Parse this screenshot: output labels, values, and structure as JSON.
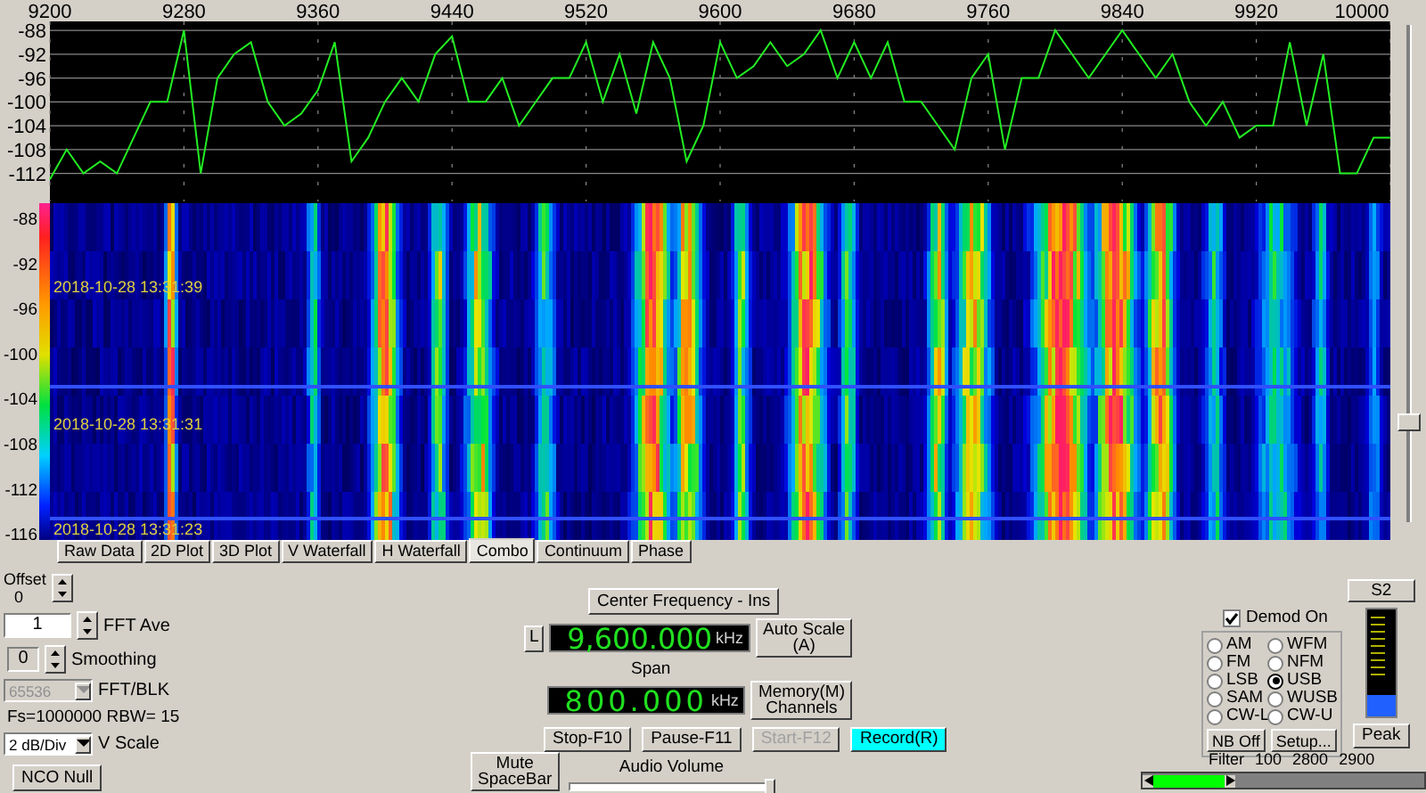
{
  "spectrum": {
    "chart_data": {
      "type": "line",
      "x": [
        9200,
        9210,
        9220,
        9230,
        9240,
        9250,
        9260,
        9270,
        9280,
        9290,
        9300,
        9310,
        9320,
        9330,
        9340,
        9350,
        9360,
        9370,
        9380,
        9390,
        9400,
        9410,
        9420,
        9430,
        9440,
        9450,
        9460,
        9470,
        9480,
        9490,
        9500,
        9510,
        9520,
        9530,
        9540,
        9550,
        9560,
        9570,
        9580,
        9590,
        9600,
        9610,
        9620,
        9630,
        9640,
        9650,
        9660,
        9670,
        9680,
        9690,
        9700,
        9710,
        9720,
        9730,
        9740,
        9750,
        9760,
        9770,
        9780,
        9790,
        9800,
        9810,
        9820,
        9830,
        9840,
        9850,
        9860,
        9870,
        9880,
        9890,
        9900,
        9910,
        9920,
        9930,
        9940,
        9950,
        9960,
        9970,
        9980,
        9990,
        10000
      ],
      "series": [
        {
          "color": "#22ee22",
          "values": [
            -113,
            -108,
            -112,
            -110,
            -112,
            -106,
            -100,
            -100,
            -88,
            -112,
            -96,
            -92,
            -90,
            -100,
            -104,
            -102,
            -98,
            -90,
            -110,
            -106,
            -100,
            -96,
            -100,
            -92,
            -89,
            -100,
            -100,
            -96,
            -104,
            -100,
            -96,
            -96,
            -90,
            -100,
            -92,
            -102,
            -90,
            -96,
            -110,
            -104,
            -90,
            -96,
            -94,
            -90,
            -94,
            -92,
            -88,
            -96,
            -90,
            -96,
            -90,
            -100,
            -100,
            -104,
            -108,
            -96,
            -92,
            -108,
            -96,
            -96,
            -88,
            -92,
            -96,
            -92,
            -88,
            -92,
            -96,
            -92,
            -100,
            -104,
            -100,
            -106,
            -104,
            -104,
            -90,
            -104,
            -92,
            -112,
            -112,
            -106,
            -106
          ]
        }
      ],
      "xlim": [
        9200,
        10000
      ],
      "ylim": [
        -117,
        -86.5
      ],
      "xticks": [
        9200,
        9280,
        9360,
        9440,
        9520,
        9600,
        9680,
        9760,
        9840,
        9920,
        10000
      ],
      "yticks": [
        -88,
        -92,
        -96,
        -100,
        -104,
        -108,
        -112
      ],
      "grid": true
    }
  },
  "waterfall": {
    "db_labels": [
      "-88",
      "-92",
      "-96",
      "-100",
      "-104",
      "-108",
      "-112",
      "-116"
    ],
    "timestamps": [
      "2018-10-28 13:31:39",
      "2018-10-28 13:31:31",
      "2018-10-28 13:31:23"
    ]
  },
  "side_slider": {
    "level": 0.22
  },
  "tabs": [
    {
      "label": "Raw Data",
      "selected": false
    },
    {
      "label": "2D Plot",
      "selected": false
    },
    {
      "label": "3D Plot",
      "selected": false
    },
    {
      "label": "V Waterfall",
      "selected": false
    },
    {
      "label": "H Waterfall",
      "selected": false
    },
    {
      "label": "Combo",
      "selected": true
    },
    {
      "label": "Continuum",
      "selected": false
    },
    {
      "label": "Phase",
      "selected": false
    }
  ],
  "offset": {
    "label": "Offset",
    "value": "0"
  },
  "fft_ave": {
    "value": "1",
    "label": "FFT Ave"
  },
  "smoothing": {
    "value": "0",
    "label": "Smoothing"
  },
  "fft_blk": {
    "value": "65536",
    "label": "FFT/BLK",
    "disabled": true
  },
  "sample_info": "Fs=1000000 RBW= 15",
  "v_scale": {
    "value": "2 dB/Div",
    "label": "V Scale"
  },
  "nco_null": "NCO Null",
  "center_frequency": {
    "button": "Center Frequency - Ins",
    "lock": "L",
    "value": "9,600.000",
    "unit": "kHz"
  },
  "auto_scale": [
    "Auto Scale",
    "(A)"
  ],
  "span": {
    "label": "Span",
    "value": "800.000",
    "unit": "kHz"
  },
  "memory": [
    "Memory(M)",
    "Channels"
  ],
  "transport": [
    {
      "label": "Stop-F10",
      "disabled": false,
      "active": false
    },
    {
      "label": "Pause-F11",
      "disabled": false,
      "active": false
    },
    {
      "label": "Start-F12",
      "disabled": true,
      "active": false
    },
    {
      "label": "Record(R)",
      "disabled": false,
      "active": true
    }
  ],
  "mute": [
    "Mute",
    "SpaceBar"
  ],
  "audio_volume": {
    "label": "Audio Volume",
    "level": 1.0
  },
  "s_meter": {
    "button": "S2",
    "level": 0.2
  },
  "demod": {
    "label": "Demod On",
    "checked": true,
    "modes": [
      {
        "label": "AM",
        "selected": false
      },
      {
        "label": "WFM",
        "selected": false
      },
      {
        "label": "FM",
        "selected": false
      },
      {
        "label": "NFM",
        "selected": false
      },
      {
        "label": "LSB",
        "selected": false
      },
      {
        "label": "USB",
        "selected": true
      },
      {
        "label": "SAM",
        "selected": false
      },
      {
        "label": "WUSB",
        "selected": false
      },
      {
        "label": "CW-L",
        "selected": false
      },
      {
        "label": "CW-U",
        "selected": false
      }
    ],
    "nb": "NB Off",
    "setup": "Setup..."
  },
  "peak": "Peak",
  "filter": {
    "label": "Filter",
    "values": [
      "100",
      "2800",
      "2900"
    ]
  }
}
